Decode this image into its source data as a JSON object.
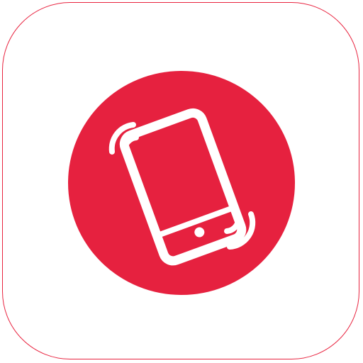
{
  "icon": {
    "name": "vibrating-phone-icon",
    "colors": {
      "accent": "#e6213f",
      "border": "#e8233f",
      "background": "#ffffff",
      "glyph": "#ffffff"
    }
  }
}
